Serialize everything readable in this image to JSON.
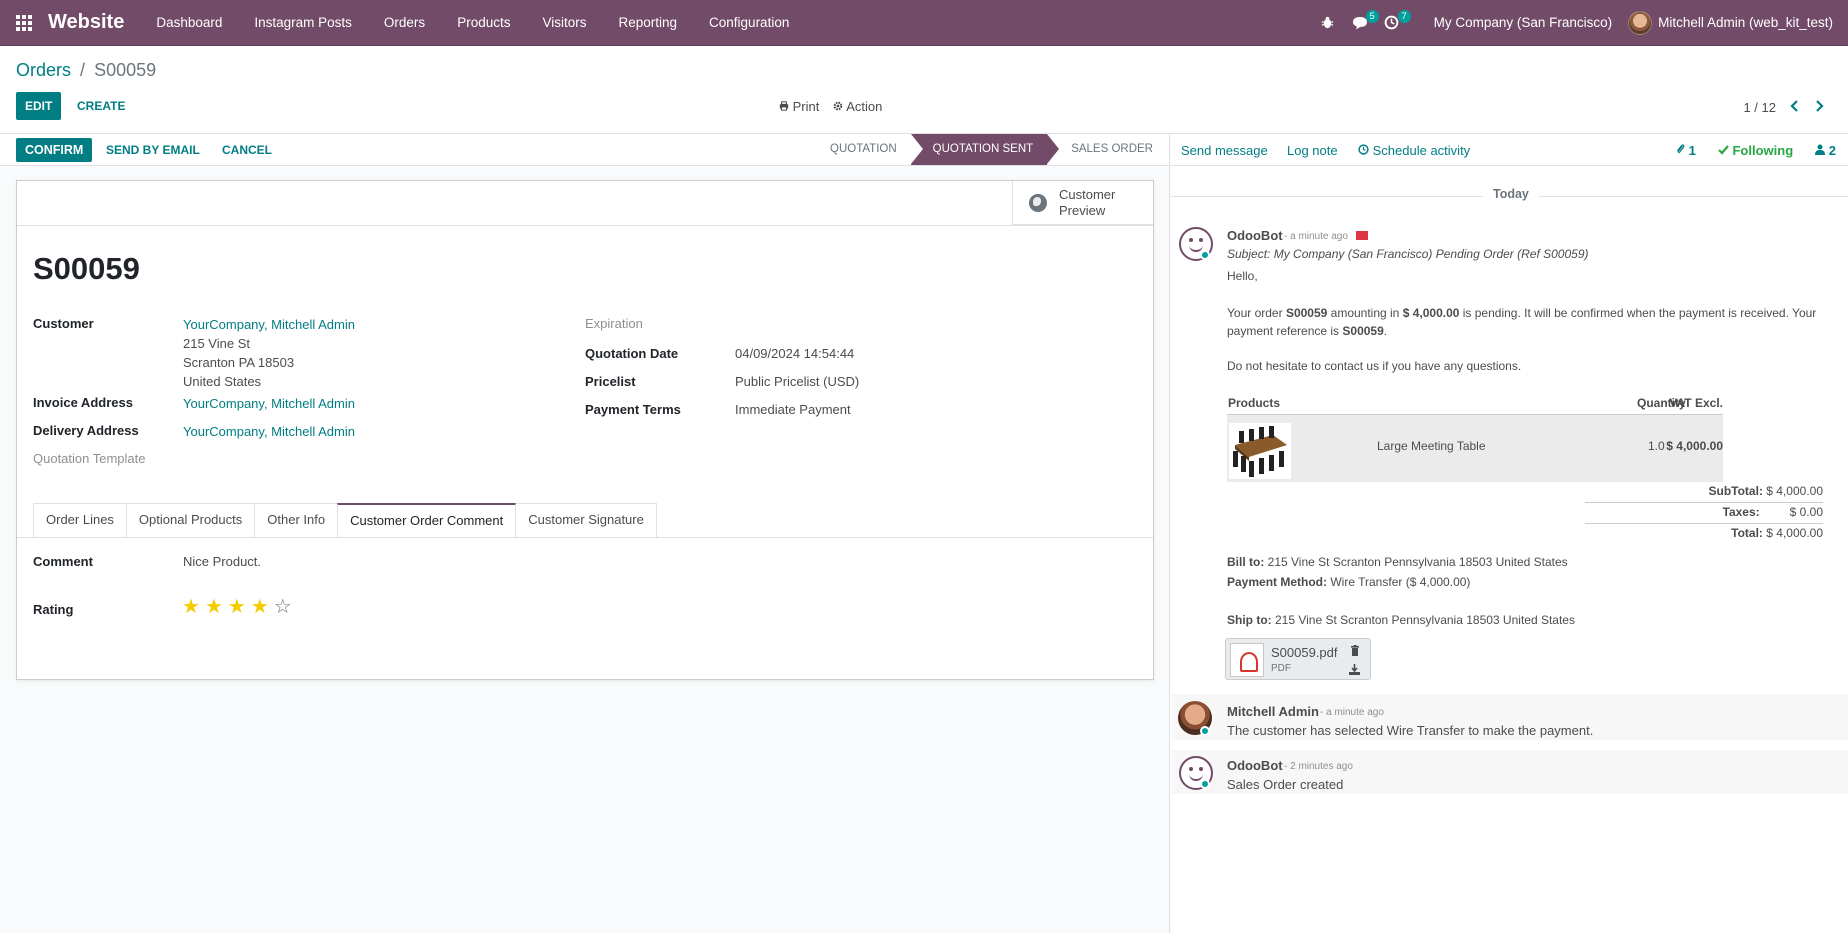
{
  "navbar": {
    "app_name": "Website",
    "menu": [
      "Dashboard",
      "Instagram Posts",
      "Orders",
      "Products",
      "Visitors",
      "Reporting",
      "Configuration"
    ],
    "messages_count": "5",
    "activities_count": "7",
    "company": "My Company (San Francisco)",
    "user": "Mitchell Admin (web_kit_test)"
  },
  "control_panel": {
    "breadcrumb_parent": "Orders",
    "breadcrumb_sep": "/",
    "breadcrumb_current": "S00059",
    "edit_label": "EDIT",
    "create_label": "CREATE",
    "print_label": "Print",
    "action_label": "Action",
    "pager": "1 / 12"
  },
  "statusbar": {
    "confirm_label": "CONFIRM",
    "send_email_label": "SEND BY EMAIL",
    "cancel_label": "CANCEL",
    "stages": [
      "QUOTATION",
      "QUOTATION SENT",
      "SALES ORDER"
    ],
    "active_stage": "QUOTATION SENT"
  },
  "sheet": {
    "customer_preview_line1": "Customer",
    "customer_preview_line2": "Preview",
    "record_name": "S00059",
    "labels": {
      "customer": "Customer",
      "invoice_address": "Invoice Address",
      "delivery_address": "Delivery Address",
      "quotation_template": "Quotation Template",
      "expiration": "Expiration",
      "quotation_date": "Quotation Date",
      "pricelist": "Pricelist",
      "payment_terms": "Payment Terms",
      "comment": "Comment",
      "rating": "Rating"
    },
    "values": {
      "customer": "YourCompany, Mitchell Admin",
      "address_line1": "215 Vine St",
      "address_line2": "Scranton PA 18503",
      "address_line3": "United States",
      "invoice_address": "YourCompany, Mitchell Admin",
      "delivery_address": "YourCompany, Mitchell Admin",
      "quotation_date": "04/09/2024 14:54:44",
      "pricelist": "Public Pricelist (USD)",
      "payment_terms": "Immediate Payment",
      "comment": "Nice Product."
    },
    "rating": 4,
    "rating_max": 5,
    "tabs": [
      "Order Lines",
      "Optional Products",
      "Other Info",
      "Customer Order Comment",
      "Customer Signature"
    ],
    "active_tab": "Customer Order Comment"
  },
  "chatter": {
    "send_message": "Send message",
    "log_note": "Log note",
    "schedule_activity": "Schedule activity",
    "attachments_count": "1",
    "following": "Following",
    "followers_count": "2",
    "today_label": "Today",
    "messages": [
      {
        "author": "OdooBot",
        "time": "- a minute ago",
        "subject": "Subject: My Company (San Francisco) Pending Order (Ref S00059)",
        "greeting": "Hello,",
        "body_p1_a": "Your order ",
        "body_p1_b": "S00059",
        "body_p1_c": " amounting in ",
        "body_p1_d": "$ 4,000.00",
        "body_p1_e": " is pending. It will be confirmed when the payment is received. Your",
        "body_p1_f": "payment reference is ",
        "body_p1_g": "S00059",
        "body_p1_h": ".",
        "body_p2": "Do not hesitate to contact us if you have any questions.",
        "table_headers": [
          "Products",
          "Quantity",
          "VAT Excl."
        ],
        "product_name": "Large Meeting Table",
        "product_qty": "1.0",
        "product_price": "$ 4,000.00",
        "subtotal_label": "SubTotal:",
        "subtotal": "$ 4,000.00",
        "taxes_label": "Taxes:",
        "taxes": "$ 0.00",
        "total_label": "Total:",
        "total": "$ 4,000.00",
        "bill_to_label": "Bill to:",
        "bill_to": " 215 Vine St Scranton Pennsylvania 18503 United States",
        "payment_method_label": "Payment Method:",
        "payment_method": " Wire Transfer ($ 4,000.00)",
        "ship_to_label": "Ship to:",
        "ship_to": " 215 Vine St Scranton Pennsylvania 18503 United States",
        "attachment_name": "S00059.pdf",
        "attachment_type": "PDF"
      },
      {
        "author": "Mitchell Admin",
        "time": "- a minute ago",
        "body": "The customer has selected Wire Transfer to make the payment."
      },
      {
        "author": "OdooBot",
        "time": "- 2 minutes ago",
        "body": "Sales Order created"
      }
    ]
  },
  "colors": {
    "brand": "#714b67",
    "accent": "#017e84",
    "star": "#f3cc00",
    "following": "#28a745"
  }
}
